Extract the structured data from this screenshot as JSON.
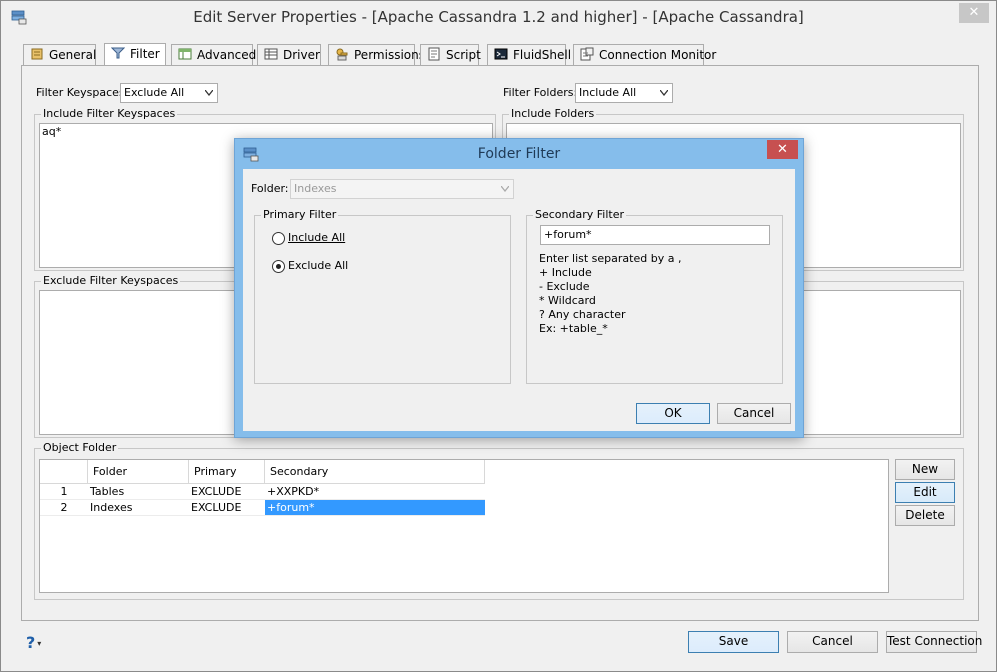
{
  "window": {
    "title": "Edit Server Properties - [Apache Cassandra 1.2 and higher] - [Apache Cassandra]",
    "close_glyph": "✕"
  },
  "tabs": [
    {
      "label": "General",
      "icon": "general-icon"
    },
    {
      "label": "Filter",
      "icon": "filter-icon",
      "active": true
    },
    {
      "label": "Advanced",
      "icon": "advanced-icon"
    },
    {
      "label": "Driver",
      "icon": "driver-icon"
    },
    {
      "label": "Permissions",
      "icon": "permissions-icon"
    },
    {
      "label": "Script",
      "icon": "script-icon"
    },
    {
      "label": "FluidShell",
      "icon": "fluidshell-icon"
    },
    {
      "label": "Connection Monitor",
      "icon": "connection-monitor-icon"
    }
  ],
  "filter": {
    "keyspaces_label": "Filter Keyspaces",
    "keyspaces_value": "Exclude All",
    "folders_label": "Filter Folders:",
    "folders_value": "Include All",
    "include_keyspaces_title": "Include Filter Keyspaces",
    "include_keyspaces_text": "aq*",
    "include_folders_title": "Include Folders",
    "exclude_keyspaces_title": "Exclude Filter Keyspaces"
  },
  "object_folder": {
    "title": "Object Folder",
    "columns": [
      "Folder",
      "Primary",
      "Secondary"
    ],
    "rows": [
      {
        "num": "1",
        "folder": "Tables",
        "primary": "EXCLUDE",
        "secondary": "+XXPKD*"
      },
      {
        "num": "2",
        "folder": "Indexes",
        "primary": "EXCLUDE",
        "secondary": "+forum*"
      }
    ],
    "new_label": "New",
    "edit_label": "Edit",
    "delete_label": "Delete"
  },
  "footer": {
    "help_glyph": "?",
    "dropdown_glyph": "▾",
    "save_label": "Save",
    "cancel_label": "Cancel",
    "test_label": "Test Connection"
  },
  "dialog": {
    "title": "Folder Filter",
    "close_glyph": "✕",
    "folder_label": "Folder:",
    "folder_value": "Indexes",
    "primary_title": "Primary Filter",
    "include_all": "Include All",
    "exclude_all": "Exclude All",
    "secondary_title": "Secondary Filter",
    "secondary_value": "+forum*",
    "hint_lines": [
      "Enter list separated by a ,",
      "+ Include",
      "- Exclude",
      "* Wildcard",
      "? Any character",
      "Ex: +table_*"
    ],
    "ok_label": "OK",
    "cancel_label": "Cancel"
  },
  "colors": {
    "selection": "#3399ff",
    "dialog_frame": "#85bdeb",
    "dialog_close": "#c75050"
  }
}
